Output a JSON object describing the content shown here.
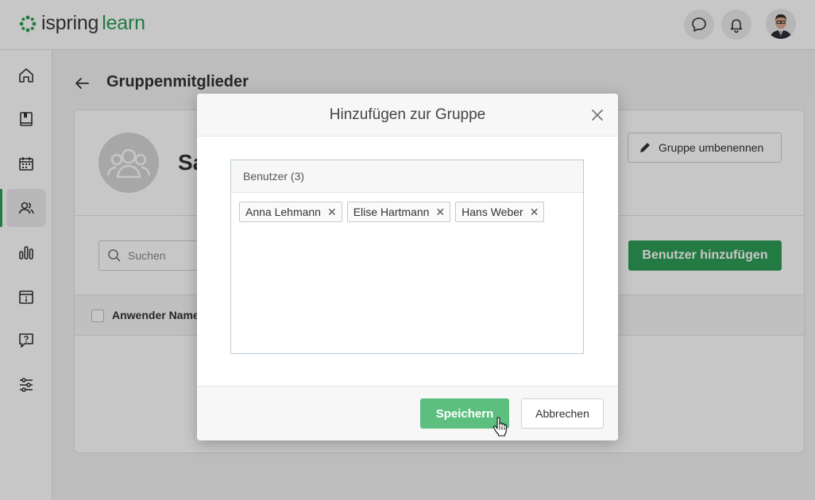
{
  "app": {
    "logo_brand": "ispring",
    "logo_product": "learn",
    "accent_color": "#2f9d57"
  },
  "header": {
    "icons": [
      "chat-icon",
      "bell-icon",
      "user-avatar"
    ]
  },
  "sidebar": {
    "items": [
      {
        "icon": "home-icon",
        "active": false
      },
      {
        "icon": "book-icon",
        "active": false
      },
      {
        "icon": "calendar-icon",
        "active": false
      },
      {
        "icon": "users-icon",
        "active": true
      },
      {
        "icon": "chart-icon",
        "active": false
      },
      {
        "icon": "info-calendar-icon",
        "active": false
      },
      {
        "icon": "help-icon",
        "active": false
      },
      {
        "icon": "sliders-icon",
        "active": false
      }
    ]
  },
  "page": {
    "title": "Gruppenmitglieder",
    "group_name": "Sa",
    "rename_label": "Gruppe umbenennen",
    "search_placeholder": "Suchen",
    "add_users_label": "Benutzer hinzufügen",
    "column_name": "Anwender Name"
  },
  "modal": {
    "title": "Hinzufügen zur Gruppe",
    "users_header": "Benutzer (3)",
    "chips": [
      "Anna Lehmann",
      "Elise Hartmann",
      "Hans Weber"
    ],
    "save_label": "Speichern",
    "cancel_label": "Abbrechen"
  }
}
